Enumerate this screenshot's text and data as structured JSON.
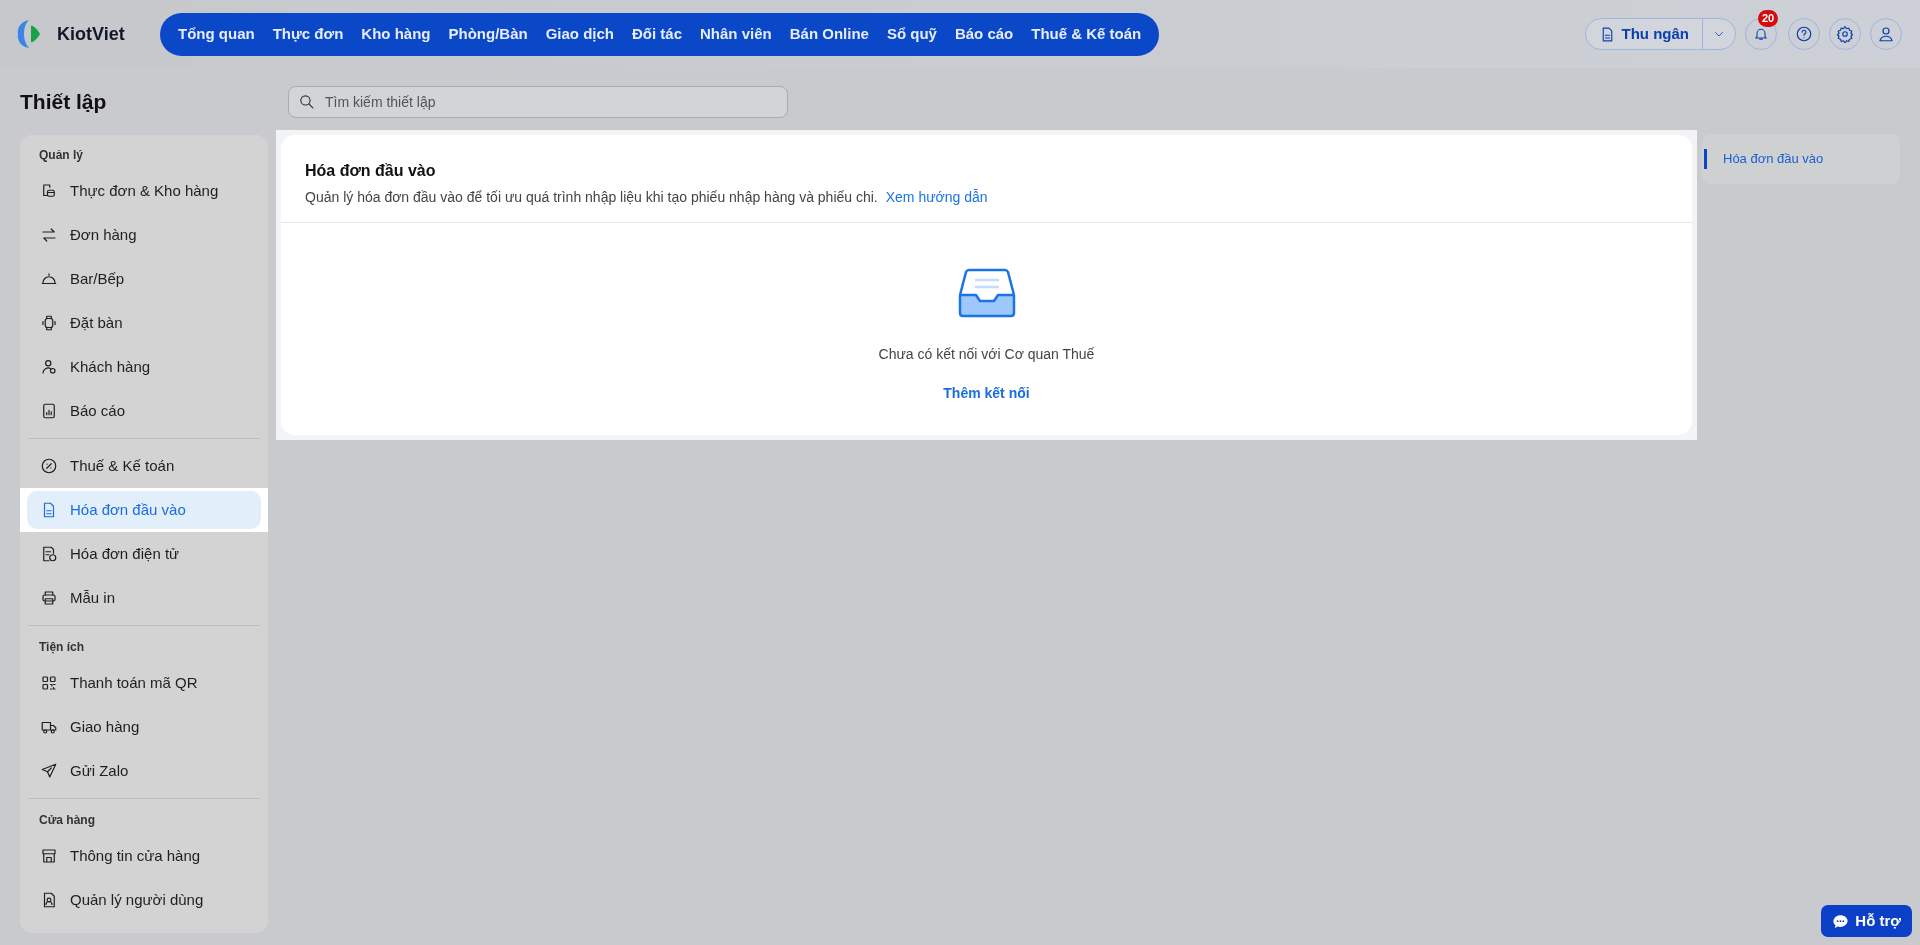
{
  "app": {
    "logo_text": "KiotViet"
  },
  "nav": [
    {
      "label": "Tổng quan"
    },
    {
      "label": "Thực đơn"
    },
    {
      "label": "Kho hàng"
    },
    {
      "label": "Phòng/Bàn"
    },
    {
      "label": "Giao dịch"
    },
    {
      "label": "Đối tác"
    },
    {
      "label": "Nhân viên"
    },
    {
      "label": "Bán Online"
    },
    {
      "label": "Sổ quỹ"
    },
    {
      "label": "Báo cáo"
    },
    {
      "label": "Thuế & Kế toán"
    }
  ],
  "header_actions": {
    "role_button": "Thu ngân",
    "notification_count": "20"
  },
  "page_title": "Thiết lập",
  "search": {
    "placeholder": "Tìm kiếm thiết lập"
  },
  "sidebar": {
    "sections": [
      {
        "title": "Quản lý",
        "items": [
          {
            "label": "Thực đơn & Kho hàng",
            "selected": false
          },
          {
            "label": "Đơn hàng",
            "selected": false
          },
          {
            "label": "Bar/Bếp",
            "selected": false
          },
          {
            "label": "Đặt bàn",
            "selected": false
          },
          {
            "label": "Khách hàng",
            "selected": false
          },
          {
            "label": "Báo cáo",
            "selected": false
          }
        ]
      },
      {
        "items": [
          {
            "label": "Thuế & Kế toán",
            "selected": false
          },
          {
            "label": "Hóa đơn đầu vào",
            "selected": true
          },
          {
            "label": "Hóa đơn điện tử",
            "selected": false
          },
          {
            "label": "Mẫu in",
            "selected": false
          }
        ]
      },
      {
        "title": "Tiện ích",
        "items": [
          {
            "label": "Thanh toán mã QR",
            "selected": false
          },
          {
            "label": "Giao hàng",
            "selected": false
          },
          {
            "label": "Gửi Zalo",
            "selected": false
          }
        ]
      },
      {
        "title": "Cửa hàng",
        "items": [
          {
            "label": "Thông tin cửa hàng",
            "selected": false
          },
          {
            "label": "Quản lý người dùng",
            "selected": false
          }
        ]
      }
    ]
  },
  "card": {
    "title": "Hóa đơn đầu vào",
    "description": "Quản lý hóa đơn đầu vào để tối ưu quá trình nhập liệu khi tạo phiếu nhập hàng và phiếu chi.",
    "link": "Xem hướng dẫn",
    "empty_message": "Chưa có kết nối với Cơ quan Thuế",
    "action": "Thêm kết nối"
  },
  "toc": [
    {
      "label": "Hóa đơn đầu vào",
      "selected": true
    }
  ],
  "help_button": "Hỗ trợ"
}
